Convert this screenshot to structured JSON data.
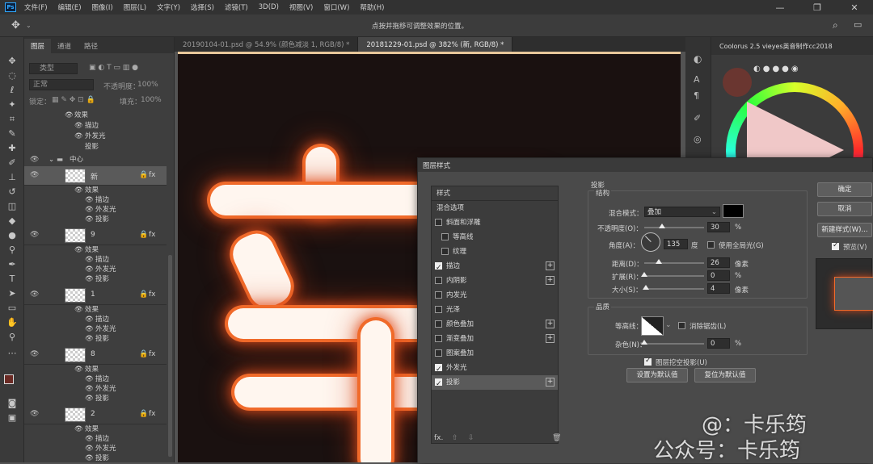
{
  "app": {
    "logo": "Ps"
  },
  "menu": [
    "文件(F)",
    "编辑(E)",
    "图像(I)",
    "图层(L)",
    "文字(Y)",
    "选择(S)",
    "滤镜(T)",
    "3D(D)",
    "视图(V)",
    "窗口(W)",
    "帮助(H)"
  ],
  "window_controls": {
    "minimize": "—",
    "restore": "❐",
    "close": "✕"
  },
  "options_bar": {
    "hint": "点按并拖移可调整效果的位置。"
  },
  "layers_panel": {
    "tabs": [
      "图层",
      "通道",
      "路径"
    ],
    "filter_label": "类型",
    "blend_mode": "正常",
    "opacity_label": "不透明度：",
    "opacity_value": "100%",
    "lock_label": "锁定：",
    "fill_label": "填充：",
    "fill_value": "100%",
    "group_name": "中心",
    "effects_label": "效果",
    "stroke_label": "描边",
    "outer_glow_label": "外发光",
    "shadow_label": "投影",
    "layers": [
      {
        "name": "新"
      },
      {
        "name": "9"
      },
      {
        "name": "1"
      },
      {
        "name": "8"
      },
      {
        "name": "2"
      }
    ],
    "fx": "fx"
  },
  "doc_tabs": [
    {
      "label": "20190104-01.psd @ 54.9% (颜色减淡 1, RGB/8) *",
      "active": false
    },
    {
      "label": "20181229-01.psd @ 382% (新, RGB/8) *",
      "active": true
    }
  ],
  "right_panel": {
    "title": "Coolorus 2.5 vieyes英音制作cc2018"
  },
  "dialog": {
    "title": "图层样式",
    "styles_header": "样式",
    "blend_options": "混合选项",
    "items": [
      {
        "label": "斜面和浮雕",
        "checked": false,
        "plus": false
      },
      {
        "label": "等高线",
        "checked": false,
        "plus": false
      },
      {
        "label": "纹理",
        "checked": false,
        "plus": false
      },
      {
        "label": "描边",
        "checked": true,
        "plus": true
      },
      {
        "label": "内阴影",
        "checked": false,
        "plus": true
      },
      {
        "label": "内发光",
        "checked": false,
        "plus": false
      },
      {
        "label": "光泽",
        "checked": false,
        "plus": false
      },
      {
        "label": "颜色叠加",
        "checked": false,
        "plus": true
      },
      {
        "label": "渐变叠加",
        "checked": false,
        "plus": true
      },
      {
        "label": "图案叠加",
        "checked": false,
        "plus": false
      },
      {
        "label": "外发光",
        "checked": true,
        "plus": false
      },
      {
        "label": "投影",
        "checked": true,
        "plus": true
      }
    ],
    "footer_fx": "fx.",
    "footer_up": "⇧",
    "footer_down": "⇩",
    "footer_delete": "🗑",
    "section_title": "投影",
    "structure_title": "结构",
    "blend_mode_label": "混合模式：",
    "blend_mode_value": "叠加",
    "opacity_label": "不透明度(O)：",
    "opacity_value": "30",
    "opacity_unit": "%",
    "opacity_level": 0.3,
    "angle_label": "角度(A)：",
    "angle_value": "135",
    "angle_unit": "度",
    "global_light_label": "使用全局光(G)",
    "distance_label": "距离(D)：",
    "distance_value": "26",
    "distance_unit": "像素",
    "spread_label": "扩展(R)：",
    "spread_value": "0",
    "spread_unit": "%",
    "size_label": "大小(S)：",
    "size_value": "4",
    "size_unit": "像素",
    "quality_title": "品质",
    "contour_label": "等高线：",
    "antialias_label": "消除锯齿(L)",
    "noise_label": "杂色(N)：",
    "noise_value": "0",
    "noise_unit": "%",
    "knockout_label": "图层挖空投影(U)",
    "set_default": "设置为默认值",
    "reset_default": "复位为默认值",
    "ok": "确定",
    "cancel": "取消",
    "new_style": "新建样式(W)...",
    "preview_label": "预览(V)",
    "shadow_color": "#000000"
  },
  "watermark": {
    "line1": "@：卡乐筠",
    "line2": "公众号：卡乐筠"
  },
  "colors": {
    "accent_glow": "#f06a2a",
    "panel": "#3e3e3e"
  }
}
